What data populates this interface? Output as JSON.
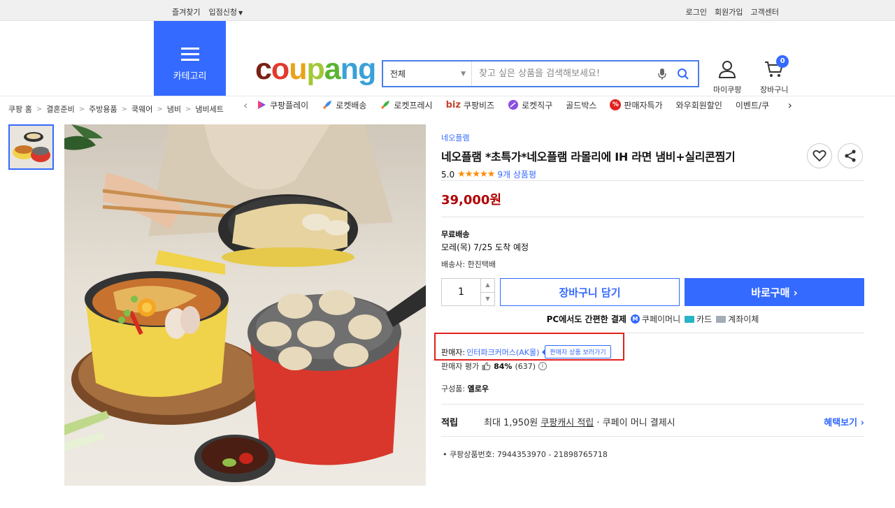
{
  "topbar": {
    "bookmark": "즐겨찾기",
    "store_apply": "입점신청",
    "login": "로그인",
    "signup": "회원가입",
    "cs": "고객센터"
  },
  "header": {
    "category_label": "카테고리",
    "logo": {
      "c": "c",
      "o1": "o",
      "u": "u",
      "p": "p",
      "a": "a",
      "n": "n",
      "g": "g"
    },
    "search_scope": "전체",
    "search_placeholder": "찾고 싶은 상품을 검색해보세요!",
    "mypage": "마이쿠팡",
    "cart": "장바구니",
    "cart_count": "0"
  },
  "subnav": {
    "items": [
      "쿠팡플레이",
      "로켓배송",
      "로켓프레시",
      "쿠팡비즈",
      "로켓직구",
      "골드박스",
      "판매자특가",
      "와우회원할인",
      "이벤트/쿠"
    ],
    "biz_prefix": "biz"
  },
  "breadcrumb": [
    "쿠팡 홈",
    "결혼준비",
    "주방용품",
    "쿡웨어",
    "냄비",
    "냄비세트"
  ],
  "product": {
    "brand": "네오플램",
    "title": "네오플램 *초특가*네오플램 라몰리에 IH 라면 냄비+실리콘찜기",
    "rating": "5.0",
    "stars": "★★★★★",
    "review_count": "9개 상품평",
    "price": "39,000원",
    "shipping_label": "무료배송",
    "arrival": "모레(목) 7/25 도착 예정",
    "carrier": "배송사: 한진택배",
    "quantity": "1",
    "add_to_cart": "장바구니 담기",
    "buy_now": "바로구매",
    "pay_title": "PC에서도 간편한 결제",
    "pay_methods": [
      "쿠페이머니",
      "카드",
      "계좌이체"
    ],
    "seller_label": "판매자:",
    "seller_name": "인터파크커머스(AK몰)",
    "seller_tooltip": "판매자 상품 보러가기",
    "seller_eval_label": "판매자 평가",
    "seller_eval_pct": "84%",
    "seller_eval_count": "(637)",
    "option_label": "구성품:",
    "option_value": "옐로우",
    "reward_label": "적립",
    "reward_text_1": "최대 1,950원 ",
    "reward_text_link": "쿠팡캐시 적립",
    "reward_text_2": " · 쿠페이 머니 결제시",
    "reward_more": "혜택보기",
    "product_id": "쿠팡상품번호: 7944353970 - 21898765718"
  },
  "colors": {
    "accent": "#346aff",
    "price": "#ae0000",
    "highlight": "#e0211d",
    "star": "#ff8c00"
  }
}
